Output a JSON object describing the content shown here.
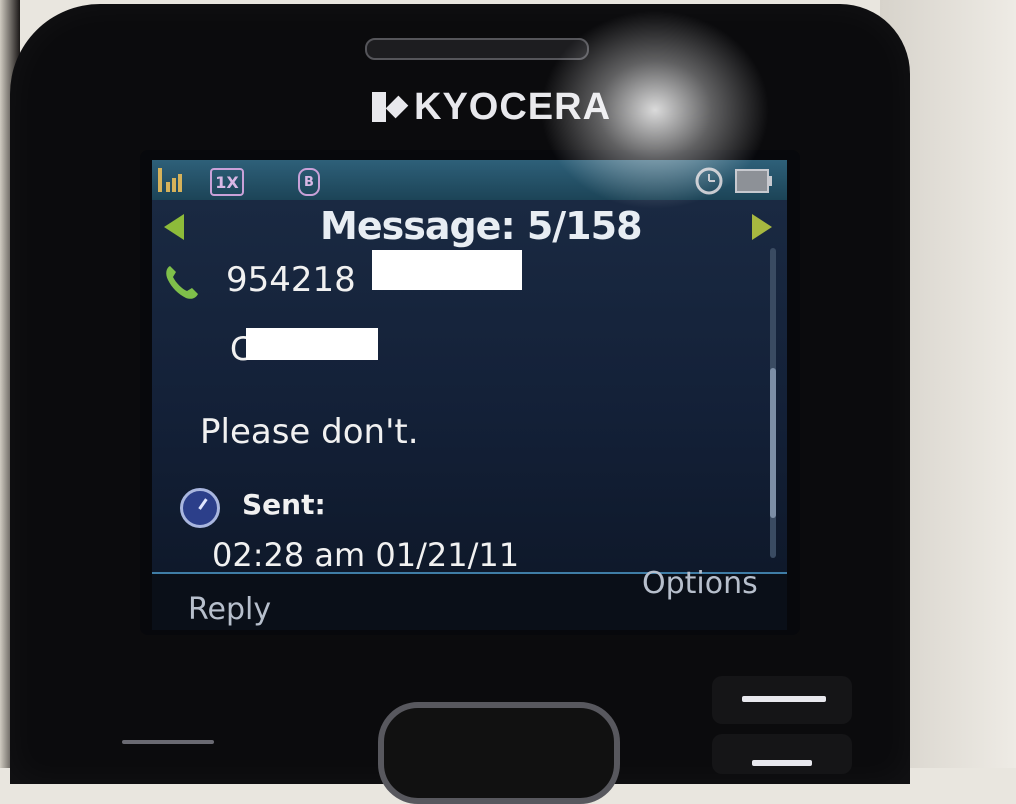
{
  "device": {
    "brand": "KYOCERA"
  },
  "status_bar": {
    "network_label": "1X",
    "bluetooth_label": "B"
  },
  "message_view": {
    "title": "Message: 5/158",
    "sender_number_visible": "954218",
    "sender_name_visible": "C",
    "body": "Please don't.",
    "sent_label": "Sent:",
    "sent_datetime": "02:28 am 01/21/11"
  },
  "softkeys": {
    "left": "Reply",
    "right": "Options"
  },
  "colors": {
    "screen_bg": "#132037",
    "status_bar": "#2e6079",
    "nav_arrow": "#8dbb3a",
    "text": "#f1f1f1"
  },
  "icons": [
    "signal-icon",
    "network-1x-icon",
    "bluetooth-icon",
    "alarm-icon",
    "battery-icon",
    "prev-arrow-icon",
    "next-arrow-icon",
    "phone-icon",
    "clock-icon"
  ]
}
